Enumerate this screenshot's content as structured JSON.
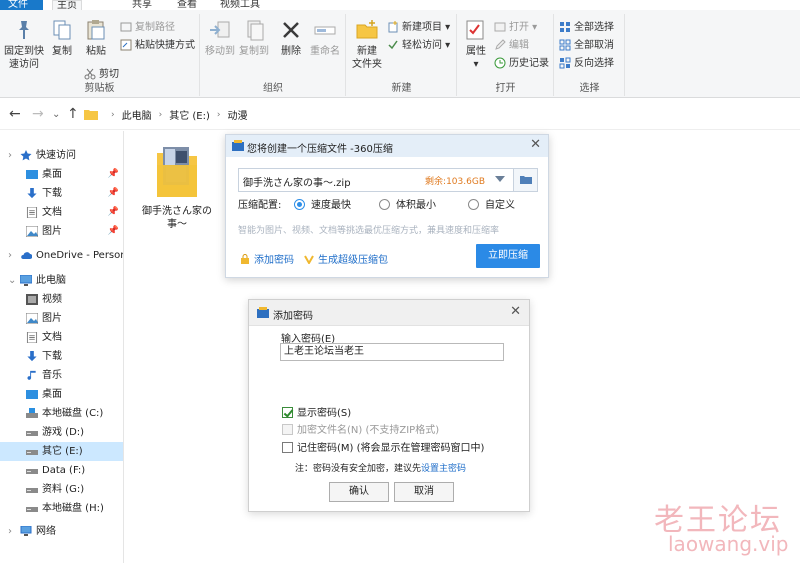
{
  "ribbon_tabs": {
    "file": "文件",
    "home": "主页",
    "share": "共享",
    "view": "查看",
    "video_tools": "视频工具"
  },
  "clipboard": {
    "pin": "固定到快",
    "pin2": "速访问",
    "copy": "复制",
    "paste": "粘贴",
    "copy_path": "复制路径",
    "paste_shortcut": "粘贴快捷方式",
    "cut": "剪切",
    "group": "剪贴板"
  },
  "organize": {
    "move_to": "移动到",
    "copy_to": "复制到",
    "delete": "删除",
    "rename": "重命名",
    "group": "组织"
  },
  "new": {
    "new_folder": "新建",
    "new_folder2": "文件夹",
    "new_item": "新建项目",
    "easy_access": "轻松访问",
    "group": "新建"
  },
  "open": {
    "properties": "属性",
    "open": "打开",
    "edit": "编辑",
    "history": "历史记录",
    "group": "打开"
  },
  "select": {
    "select_all": "全部选择",
    "select_none": "全部取消",
    "invert": "反向选择",
    "group": "选择"
  },
  "breadcrumb": {
    "pc": "此电脑",
    "drive": "其它 (E:)",
    "folder": "动漫"
  },
  "sidebar": {
    "quick_access": "快速访问",
    "desktop": "桌面",
    "downloads": "下载",
    "documents": "文档",
    "pictures": "图片",
    "onedrive": "OneDrive - Persona",
    "this_pc": "此电脑",
    "videos": "视频",
    "pictures2": "图片",
    "documents2": "文档",
    "downloads2": "下载",
    "music": "音乐",
    "desktop2": "桌面",
    "drive_c": "本地磁盘 (C:)",
    "drive_d": "游戏 (D:)",
    "drive_e": "其它 (E:)",
    "drive_f": "Data (F:)",
    "drive_g": "资料 (G:)",
    "drive_h": "本地磁盘 (H:)",
    "network": "网络"
  },
  "file": {
    "name_line1": "御手洗さん家の",
    "name_line2": "事～"
  },
  "compress_dialog": {
    "title": "您将创建一个压缩文件 -360压缩",
    "filename": "御手洗さん家の事～.zip",
    "free_space": "剩余:103.6GB",
    "config_label": "压缩配置:",
    "opt_fast": "速度最快",
    "opt_small": "体积最小",
    "opt_custom": "自定义",
    "hint": "智能为图片、视频、文档等挑选最优压缩方式，兼具速度和压缩率",
    "add_password": "添加密码",
    "super_zip": "生成超级压缩包",
    "compress_now": "立即压缩"
  },
  "password_dialog": {
    "title": "添加密码",
    "input_label": "输入密码(E)",
    "password_value": "上老王论坛当老王",
    "show_password": "显示密码(S)",
    "encrypt_names": "加密文件名(N) (不支持ZIP格式)",
    "remember": "记住密码(M) (将会显示在管理密码窗口中)",
    "note_prefix": "注：密码没有安全加密，建议先",
    "note_link": "设置主密码",
    "ok": "确认",
    "cancel": "取消"
  },
  "watermark": {
    "line1": "老王论坛",
    "line2": "laowang.vip"
  },
  "colors": {
    "accent": "#2b8ae6",
    "file_tab": "#1979ca",
    "free_space": "#e07a1f",
    "selected": "#cce8ff"
  }
}
